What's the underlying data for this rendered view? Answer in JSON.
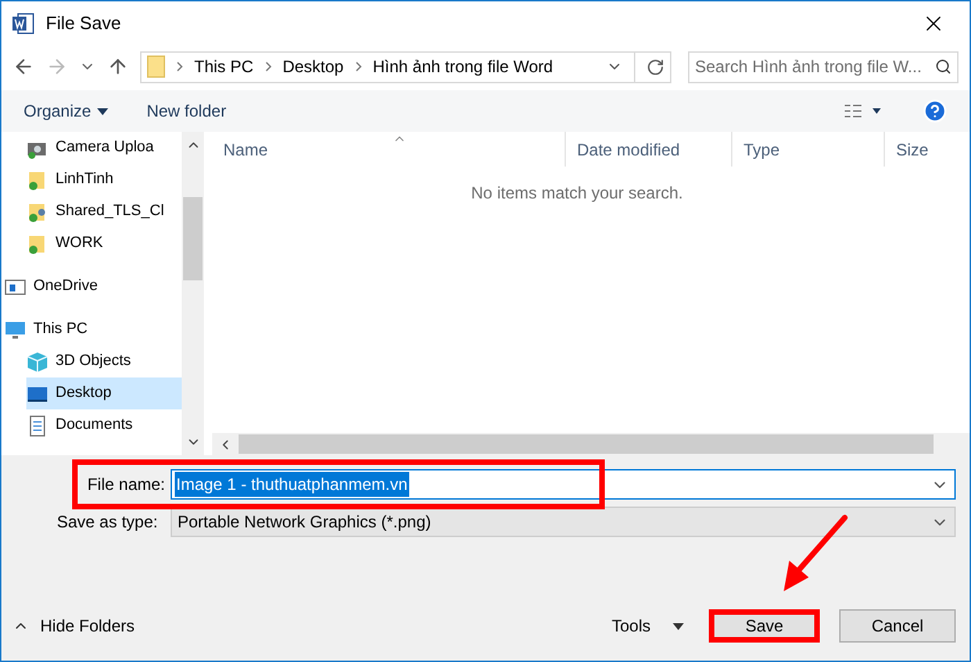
{
  "window": {
    "title": "File Save"
  },
  "address_bar": {
    "crumbs": [
      "This PC",
      "Desktop",
      "Hình ảnh trong file Word"
    ]
  },
  "search": {
    "placeholder": "Search Hình ảnh trong file W..."
  },
  "toolbar": {
    "organize": "Organize",
    "new_folder": "New folder"
  },
  "sidebar": {
    "continued_items": [
      {
        "label": "Camera Uploa",
        "kind": "camera",
        "selected": false
      },
      {
        "label": "LinhTinh",
        "kind": "folder",
        "selected": false
      },
      {
        "label": "Shared_TLS_Cl",
        "kind": "shared",
        "selected": false
      },
      {
        "label": "WORK",
        "kind": "folder",
        "selected": false
      }
    ],
    "items": [
      {
        "label": "OneDrive",
        "kind": "cloud",
        "selected": false
      },
      {
        "label": "This PC",
        "kind": "pc",
        "selected": false,
        "children": [
          {
            "label": "3D Objects",
            "kind": "cube",
            "selected": false
          },
          {
            "label": "Desktop",
            "kind": "desktop",
            "selected": true
          },
          {
            "label": "Documents",
            "kind": "document",
            "selected": false
          }
        ]
      }
    ]
  },
  "table": {
    "columns": [
      "Name",
      "Date modified",
      "Type",
      "Size"
    ],
    "empty_message": "No items match your search."
  },
  "file_name": {
    "label": "File name:",
    "value": "Image 1 - thuthuatphanmem.vn"
  },
  "save_as_type": {
    "label": "Save as type:",
    "value": "Portable Network Graphics (*.png)"
  },
  "footer": {
    "hide_folders": "Hide Folders",
    "tools": "Tools",
    "save": "Save",
    "cancel": "Cancel"
  }
}
